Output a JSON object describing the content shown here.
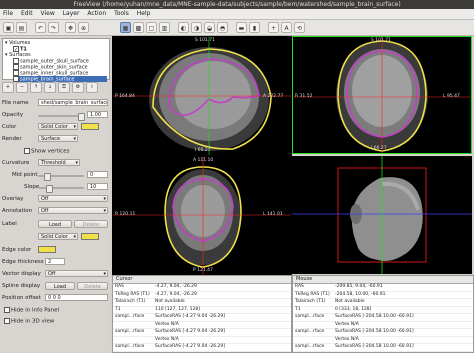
{
  "window_title": "FreeView (/home/yuhan/mne_data/MNE-sample-data/subjects/sample/bem/watershed/sample_brain_surface)",
  "menu": [
    "File",
    "Edit",
    "View",
    "Layer",
    "Action",
    "Tools",
    "Help"
  ],
  "layers": {
    "volumes_label": "Volumes",
    "volume_t1": "T1",
    "surfaces_label": "Surfaces",
    "surfaces": [
      "sample_outer_skull_surface",
      "sample_outer_skin_surface",
      "sample_inner_skull_surface",
      "sample_brain_surface"
    ]
  },
  "props": {
    "file_name_label": "File name",
    "file_name_value": "shed/sample_brain_surface",
    "opacity_label": "Opacity",
    "opacity_value": "1.00",
    "color_label": "Color",
    "color_value": "Solid Color",
    "render_label": "Render",
    "render_value": "Surface",
    "show_vertices": "Show vertices",
    "curvature_label": "Curvature",
    "curvature_value": "Threshold",
    "midpoint_label": "Mid point",
    "midpoint_value": "0",
    "slope_label": "Slope",
    "slope_value": "10",
    "overlay_label": "Overlay",
    "overlay_value": "Off",
    "annotation_label": "Annotation",
    "annotation_value": "Off",
    "label_label": "Label",
    "load": "Load",
    "delete": "Delete",
    "label_color": "Solid Color",
    "edge_color_label": "Edge color",
    "edge_thickness_label": "Edge thickness",
    "edge_thickness_value": "2",
    "vector_display_label": "Vector display",
    "vector_display_value": "Off",
    "spline_display_label": "Spline display",
    "position_offset_label": "Position offset",
    "position_offset_value": "0 0 0",
    "hide_info_panel": "Hide in Info Panel",
    "hide_3d_view": "Hide in 3D view"
  },
  "views": {
    "sagittal": {
      "top": "S 101.71",
      "left": "P 164.84",
      "right": "A 222.77",
      "bottom": "I 66.27"
    },
    "coronal": {
      "top": "S 101.71",
      "left": "R 31.52",
      "right": "L 95.47",
      "bottom": "I 66.27"
    },
    "axial": {
      "top": "A 111.10",
      "left": "R 120.11",
      "right": "L 141.01",
      "bottom": "P 121.47"
    }
  },
  "cursor_panel": {
    "header": "Cursor",
    "rows": [
      {
        "k": "RAS",
        "v": "-4.27, 9.04, -26.29"
      },
      {
        "k": "TkReg RAS (T1)",
        "v": "-4.27, 9.04, -26.29"
      },
      {
        "k": "Talairach (T1)",
        "v": "Not available"
      },
      {
        "k": "T1",
        "v": "110      [127, 127, 128]"
      },
      {
        "k": "sampl...rface",
        "v": "SurfaceRAS  [-4.27 9.04 -26.29]"
      },
      {
        "k": "",
        "v": "Vertex   N/A"
      },
      {
        "k": "sampl...rface",
        "v": "SurfaceRAS  [-4.27 9.04 -26.29]"
      },
      {
        "k": "",
        "v": "Vertex   N/A"
      },
      {
        "k": "sampl...rface",
        "v": "SurfaceRAS  [-4.27 9.04 -26.29]"
      }
    ]
  },
  "mouse_panel": {
    "header": "Mouse",
    "rows": [
      {
        "k": "RAS",
        "v": "-209.85, 9.04, -60.91"
      },
      {
        "k": "TkReg RAS (T1)",
        "v": "-204.58, 10.00, -60.91"
      },
      {
        "k": "Talairach (T1)",
        "v": "Not available"
      },
      {
        "k": "T1",
        "v": "0        [333, 18, 128]"
      },
      {
        "k": "sampl...rface",
        "v": "SurfaceRAS  [-204.58 10.00 -60.91]"
      },
      {
        "k": "",
        "v": "Vertex   N/A"
      },
      {
        "k": "sampl...rface",
        "v": "SurfaceRAS  [-204.58 10.00 -60.91]"
      },
      {
        "k": "",
        "v": "Vertex   N/A"
      },
      {
        "k": "sampl...rface",
        "v": "SurfaceRAS  [-204.58 10.00 -60.91]"
      }
    ]
  },
  "colors": {
    "skin": "#f0e04a",
    "brain": "#c040c8",
    "crosshair_red": "#ff2020",
    "crosshair_green": "#20e020",
    "accent": "#3d6db5"
  }
}
